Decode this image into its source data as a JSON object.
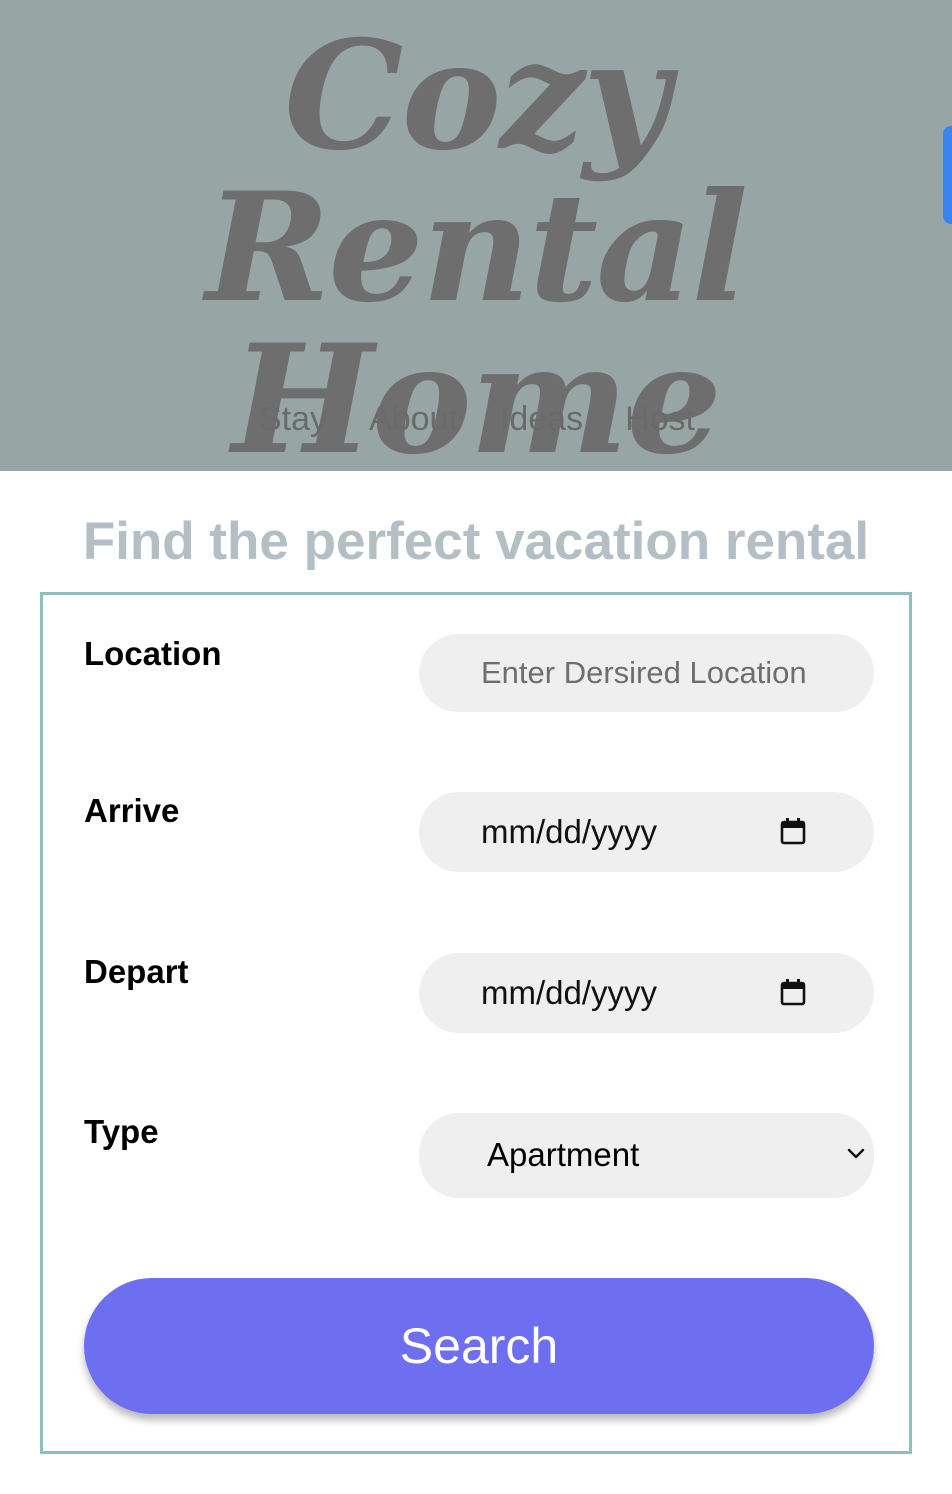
{
  "header": {
    "title_line1": "Cozy Rental",
    "title_line2": "Home",
    "nav": [
      "Stay",
      "About",
      "Ideas",
      "Host"
    ]
  },
  "main": {
    "tagline": "Find the perfect vacation rental"
  },
  "form": {
    "location": {
      "label": "Location",
      "placeholder": "Enter Dersired Location",
      "value": ""
    },
    "arrive": {
      "label": "Arrive",
      "display": "mm/dd/yyyy",
      "icon": "calendar-icon"
    },
    "depart": {
      "label": "Depart",
      "display": "mm/dd/yyyy",
      "icon": "calendar-icon"
    },
    "type": {
      "label": "Type",
      "selected": "Apartment",
      "icon": "chevron-down-icon"
    },
    "search_label": "Search"
  },
  "colors": {
    "header_bg": "#97a6a4",
    "title_text": "#6e6e6e",
    "tagline_text": "#b3bfc4",
    "form_border": "#8fbfbd",
    "field_bg": "#efefef",
    "button_bg": "#6e6ef0",
    "button_text": "#ffffff",
    "scroll_tab": "#3a84f2"
  }
}
